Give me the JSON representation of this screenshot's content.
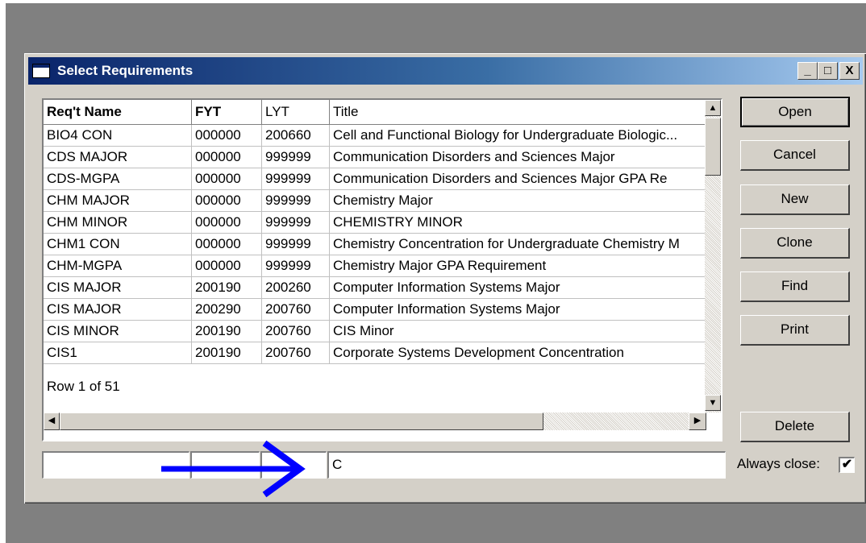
{
  "window": {
    "title": "Select Requirements",
    "controls": {
      "minimize": "_",
      "maximize": "□",
      "close": "X"
    }
  },
  "grid": {
    "columns": [
      "Req't Name",
      "FYT",
      "LYT",
      "Title"
    ],
    "rows": [
      [
        "BIO4 CON",
        "000000",
        "200660",
        "Cell and Functional Biology for Undergraduate Biologic..."
      ],
      [
        "CDS MAJOR",
        "000000",
        "999999",
        "Communication Disorders and Sciences Major"
      ],
      [
        "CDS-MGPA",
        "000000",
        "999999",
        "Communication Disorders and Sciences Major GPA Re"
      ],
      [
        "CHM MAJOR",
        "000000",
        "999999",
        "Chemistry Major"
      ],
      [
        "CHM MINOR",
        "000000",
        "999999",
        "CHEMISTRY MINOR"
      ],
      [
        "CHM1 CON",
        "000000",
        "999999",
        "Chemistry Concentration for Undergraduate Chemistry M"
      ],
      [
        "CHM-MGPA",
        "000000",
        "999999",
        "Chemistry Major GPA Requirement"
      ],
      [
        "CIS MAJOR",
        "200190",
        "200260",
        "Computer Information Systems Major"
      ],
      [
        "CIS MAJOR",
        "200290",
        "200760",
        "Computer Information Systems Major"
      ],
      [
        "CIS MINOR",
        "200190",
        "200760",
        "CIS Minor"
      ],
      [
        "CIS1",
        "200190",
        "200760",
        "Corporate Systems Development Concentration"
      ]
    ],
    "row_status": "Row 1 of 51"
  },
  "buttons": {
    "open": "Open",
    "cancel": "Cancel",
    "new": "New",
    "clone": "Clone",
    "find": "Find",
    "print": "Print",
    "delete": "Delete"
  },
  "filters": {
    "name": "",
    "fyt": "",
    "lyt": "",
    "title": "C"
  },
  "always_close": {
    "label": "Always close:",
    "checked": true,
    "mark": "✔"
  },
  "annotation": {
    "arrow_color": "#0000ff",
    "icon": "right-arrow-icon"
  }
}
